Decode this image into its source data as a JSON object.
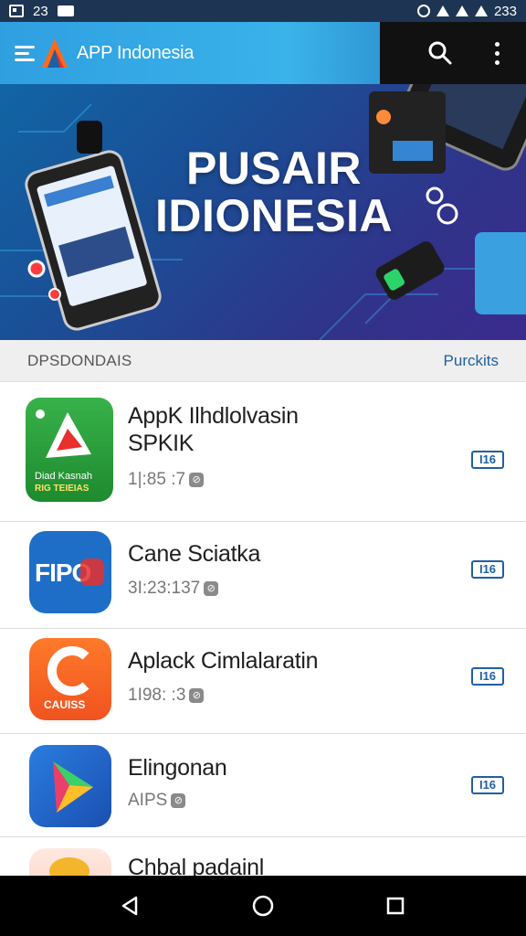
{
  "status_bar": {
    "time": "23",
    "right_text": "233"
  },
  "app_bar": {
    "title": "APP Indonesia"
  },
  "hero": {
    "line1": "PUSAIR",
    "line2": "IDIONESIA"
  },
  "section": {
    "title": "DPSDONDAIS",
    "link": "Purckits"
  },
  "apps": [
    {
      "name": "AppK Ilhdlolvasin SPKIK",
      "meta": "1|:85 :7",
      "action": "I16",
      "icon": "green-play-icon",
      "icon_text_1": "Diad Kasnah",
      "icon_text_2": "RIG TEIEIAS"
    },
    {
      "name": "Cane Sciatka",
      "meta": "3I:23:137",
      "action": "I16",
      "icon": "blue-fipo-icon",
      "icon_text_1": "FIPO"
    },
    {
      "name": "Aplack Cimlalaratin",
      "meta": "1I98: :3",
      "action": "I16",
      "icon": "orange-c-icon",
      "icon_text_1": "CAUISS"
    },
    {
      "name": "Elingonan",
      "meta": "AIPS",
      "action": "I16",
      "icon": "play-triangle-icon"
    },
    {
      "name": "Chbal padainl",
      "meta": "",
      "action": "",
      "icon": "yellow-app-icon"
    }
  ],
  "colors": {
    "accent": "#1f5fa3",
    "hero_start": "#0f6aa8",
    "hero_end": "#3b2b8c"
  }
}
